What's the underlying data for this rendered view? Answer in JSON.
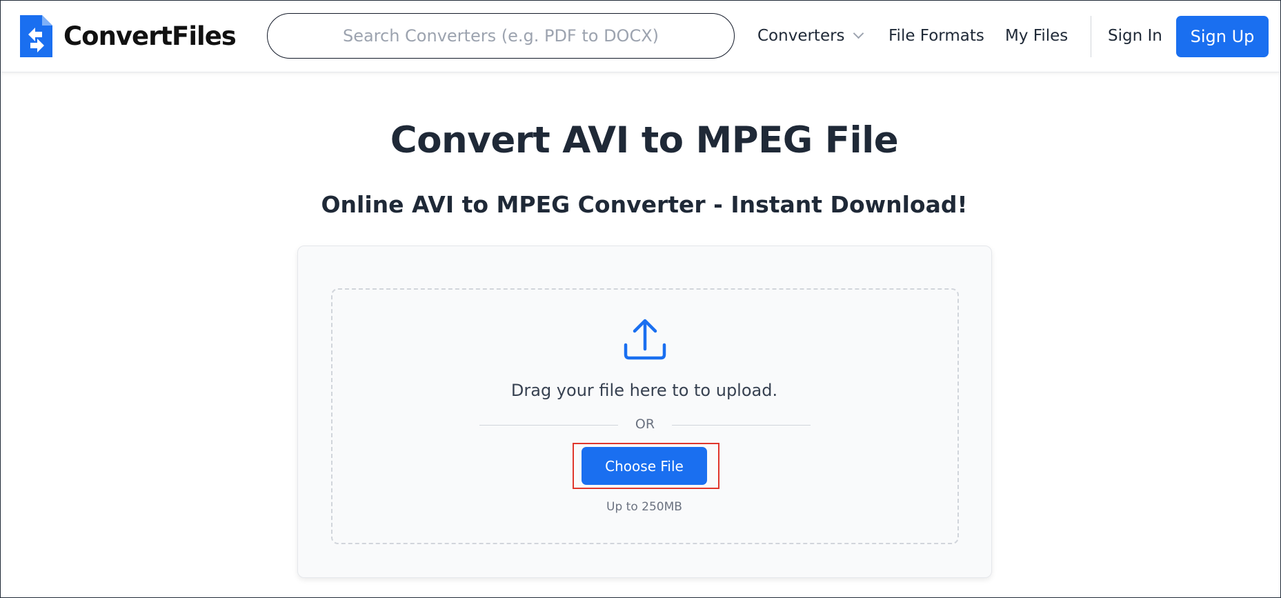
{
  "header": {
    "logo_text": "ConvertFiles",
    "search": {
      "placeholder": "Search Converters (e.g. PDF to DOCX)"
    },
    "nav": {
      "converters_label": "Converters",
      "file_formats_label": "File Formats",
      "my_files_label": "My Files",
      "sign_in_label": "Sign In",
      "sign_up_label": "Sign Up"
    }
  },
  "main": {
    "title": "Convert AVI to MPEG File",
    "subtitle": "Online AVI to MPEG Converter - Instant Download!",
    "upload": {
      "drag_text": "Drag your file here to to upload.",
      "or_text": "OR",
      "choose_file_label": "Choose File",
      "size_limit": "Up to 250MB"
    }
  },
  "icons": {
    "logo": "convertfiles-logo-icon",
    "dropdown": "chevron-down-icon",
    "upload": "upload-icon"
  },
  "colors": {
    "accent": "#1a6ff0",
    "text_dark": "#1f2937",
    "highlight_border": "#e0362c",
    "card_bg": "#f9fafb"
  }
}
